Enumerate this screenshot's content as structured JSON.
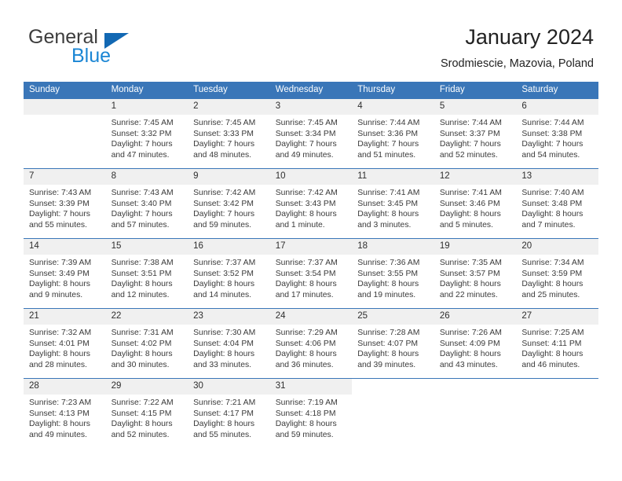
{
  "brand": {
    "name_part1": "General",
    "name_part2": "Blue",
    "triangle_color": "#1268b3",
    "blue_color": "#1b86d4"
  },
  "header": {
    "title": "January 2024",
    "subtitle": "Srodmiescie, Mazovia, Poland"
  },
  "theme": {
    "header_bg": "#3a76b8",
    "daynum_bg": "#f0f0f0",
    "text_color": "#3a3a3a"
  },
  "weekdays": [
    "Sunday",
    "Monday",
    "Tuesday",
    "Wednesday",
    "Thursday",
    "Friday",
    "Saturday"
  ],
  "weeks": [
    [
      {
        "day": "",
        "sunrise": "",
        "sunset": "",
        "daylight1": "",
        "daylight2": ""
      },
      {
        "day": "1",
        "sunrise": "Sunrise: 7:45 AM",
        "sunset": "Sunset: 3:32 PM",
        "daylight1": "Daylight: 7 hours",
        "daylight2": "and 47 minutes."
      },
      {
        "day": "2",
        "sunrise": "Sunrise: 7:45 AM",
        "sunset": "Sunset: 3:33 PM",
        "daylight1": "Daylight: 7 hours",
        "daylight2": "and 48 minutes."
      },
      {
        "day": "3",
        "sunrise": "Sunrise: 7:45 AM",
        "sunset": "Sunset: 3:34 PM",
        "daylight1": "Daylight: 7 hours",
        "daylight2": "and 49 minutes."
      },
      {
        "day": "4",
        "sunrise": "Sunrise: 7:44 AM",
        "sunset": "Sunset: 3:36 PM",
        "daylight1": "Daylight: 7 hours",
        "daylight2": "and 51 minutes."
      },
      {
        "day": "5",
        "sunrise": "Sunrise: 7:44 AM",
        "sunset": "Sunset: 3:37 PM",
        "daylight1": "Daylight: 7 hours",
        "daylight2": "and 52 minutes."
      },
      {
        "day": "6",
        "sunrise": "Sunrise: 7:44 AM",
        "sunset": "Sunset: 3:38 PM",
        "daylight1": "Daylight: 7 hours",
        "daylight2": "and 54 minutes."
      }
    ],
    [
      {
        "day": "7",
        "sunrise": "Sunrise: 7:43 AM",
        "sunset": "Sunset: 3:39 PM",
        "daylight1": "Daylight: 7 hours",
        "daylight2": "and 55 minutes."
      },
      {
        "day": "8",
        "sunrise": "Sunrise: 7:43 AM",
        "sunset": "Sunset: 3:40 PM",
        "daylight1": "Daylight: 7 hours",
        "daylight2": "and 57 minutes."
      },
      {
        "day": "9",
        "sunrise": "Sunrise: 7:42 AM",
        "sunset": "Sunset: 3:42 PM",
        "daylight1": "Daylight: 7 hours",
        "daylight2": "and 59 minutes."
      },
      {
        "day": "10",
        "sunrise": "Sunrise: 7:42 AM",
        "sunset": "Sunset: 3:43 PM",
        "daylight1": "Daylight: 8 hours",
        "daylight2": "and 1 minute."
      },
      {
        "day": "11",
        "sunrise": "Sunrise: 7:41 AM",
        "sunset": "Sunset: 3:45 PM",
        "daylight1": "Daylight: 8 hours",
        "daylight2": "and 3 minutes."
      },
      {
        "day": "12",
        "sunrise": "Sunrise: 7:41 AM",
        "sunset": "Sunset: 3:46 PM",
        "daylight1": "Daylight: 8 hours",
        "daylight2": "and 5 minutes."
      },
      {
        "day": "13",
        "sunrise": "Sunrise: 7:40 AM",
        "sunset": "Sunset: 3:48 PM",
        "daylight1": "Daylight: 8 hours",
        "daylight2": "and 7 minutes."
      }
    ],
    [
      {
        "day": "14",
        "sunrise": "Sunrise: 7:39 AM",
        "sunset": "Sunset: 3:49 PM",
        "daylight1": "Daylight: 8 hours",
        "daylight2": "and 9 minutes."
      },
      {
        "day": "15",
        "sunrise": "Sunrise: 7:38 AM",
        "sunset": "Sunset: 3:51 PM",
        "daylight1": "Daylight: 8 hours",
        "daylight2": "and 12 minutes."
      },
      {
        "day": "16",
        "sunrise": "Sunrise: 7:37 AM",
        "sunset": "Sunset: 3:52 PM",
        "daylight1": "Daylight: 8 hours",
        "daylight2": "and 14 minutes."
      },
      {
        "day": "17",
        "sunrise": "Sunrise: 7:37 AM",
        "sunset": "Sunset: 3:54 PM",
        "daylight1": "Daylight: 8 hours",
        "daylight2": "and 17 minutes."
      },
      {
        "day": "18",
        "sunrise": "Sunrise: 7:36 AM",
        "sunset": "Sunset: 3:55 PM",
        "daylight1": "Daylight: 8 hours",
        "daylight2": "and 19 minutes."
      },
      {
        "day": "19",
        "sunrise": "Sunrise: 7:35 AM",
        "sunset": "Sunset: 3:57 PM",
        "daylight1": "Daylight: 8 hours",
        "daylight2": "and 22 minutes."
      },
      {
        "day": "20",
        "sunrise": "Sunrise: 7:34 AM",
        "sunset": "Sunset: 3:59 PM",
        "daylight1": "Daylight: 8 hours",
        "daylight2": "and 25 minutes."
      }
    ],
    [
      {
        "day": "21",
        "sunrise": "Sunrise: 7:32 AM",
        "sunset": "Sunset: 4:01 PM",
        "daylight1": "Daylight: 8 hours",
        "daylight2": "and 28 minutes."
      },
      {
        "day": "22",
        "sunrise": "Sunrise: 7:31 AM",
        "sunset": "Sunset: 4:02 PM",
        "daylight1": "Daylight: 8 hours",
        "daylight2": "and 30 minutes."
      },
      {
        "day": "23",
        "sunrise": "Sunrise: 7:30 AM",
        "sunset": "Sunset: 4:04 PM",
        "daylight1": "Daylight: 8 hours",
        "daylight2": "and 33 minutes."
      },
      {
        "day": "24",
        "sunrise": "Sunrise: 7:29 AM",
        "sunset": "Sunset: 4:06 PM",
        "daylight1": "Daylight: 8 hours",
        "daylight2": "and 36 minutes."
      },
      {
        "day": "25",
        "sunrise": "Sunrise: 7:28 AM",
        "sunset": "Sunset: 4:07 PM",
        "daylight1": "Daylight: 8 hours",
        "daylight2": "and 39 minutes."
      },
      {
        "day": "26",
        "sunrise": "Sunrise: 7:26 AM",
        "sunset": "Sunset: 4:09 PM",
        "daylight1": "Daylight: 8 hours",
        "daylight2": "and 43 minutes."
      },
      {
        "day": "27",
        "sunrise": "Sunrise: 7:25 AM",
        "sunset": "Sunset: 4:11 PM",
        "daylight1": "Daylight: 8 hours",
        "daylight2": "and 46 minutes."
      }
    ],
    [
      {
        "day": "28",
        "sunrise": "Sunrise: 7:23 AM",
        "sunset": "Sunset: 4:13 PM",
        "daylight1": "Daylight: 8 hours",
        "daylight2": "and 49 minutes."
      },
      {
        "day": "29",
        "sunrise": "Sunrise: 7:22 AM",
        "sunset": "Sunset: 4:15 PM",
        "daylight1": "Daylight: 8 hours",
        "daylight2": "and 52 minutes."
      },
      {
        "day": "30",
        "sunrise": "Sunrise: 7:21 AM",
        "sunset": "Sunset: 4:17 PM",
        "daylight1": "Daylight: 8 hours",
        "daylight2": "and 55 minutes."
      },
      {
        "day": "31",
        "sunrise": "Sunrise: 7:19 AM",
        "sunset": "Sunset: 4:18 PM",
        "daylight1": "Daylight: 8 hours",
        "daylight2": "and 59 minutes."
      },
      {
        "day": "",
        "sunrise": "",
        "sunset": "",
        "daylight1": "",
        "daylight2": ""
      },
      {
        "day": "",
        "sunrise": "",
        "sunset": "",
        "daylight1": "",
        "daylight2": ""
      },
      {
        "day": "",
        "sunrise": "",
        "sunset": "",
        "daylight1": "",
        "daylight2": ""
      }
    ]
  ]
}
